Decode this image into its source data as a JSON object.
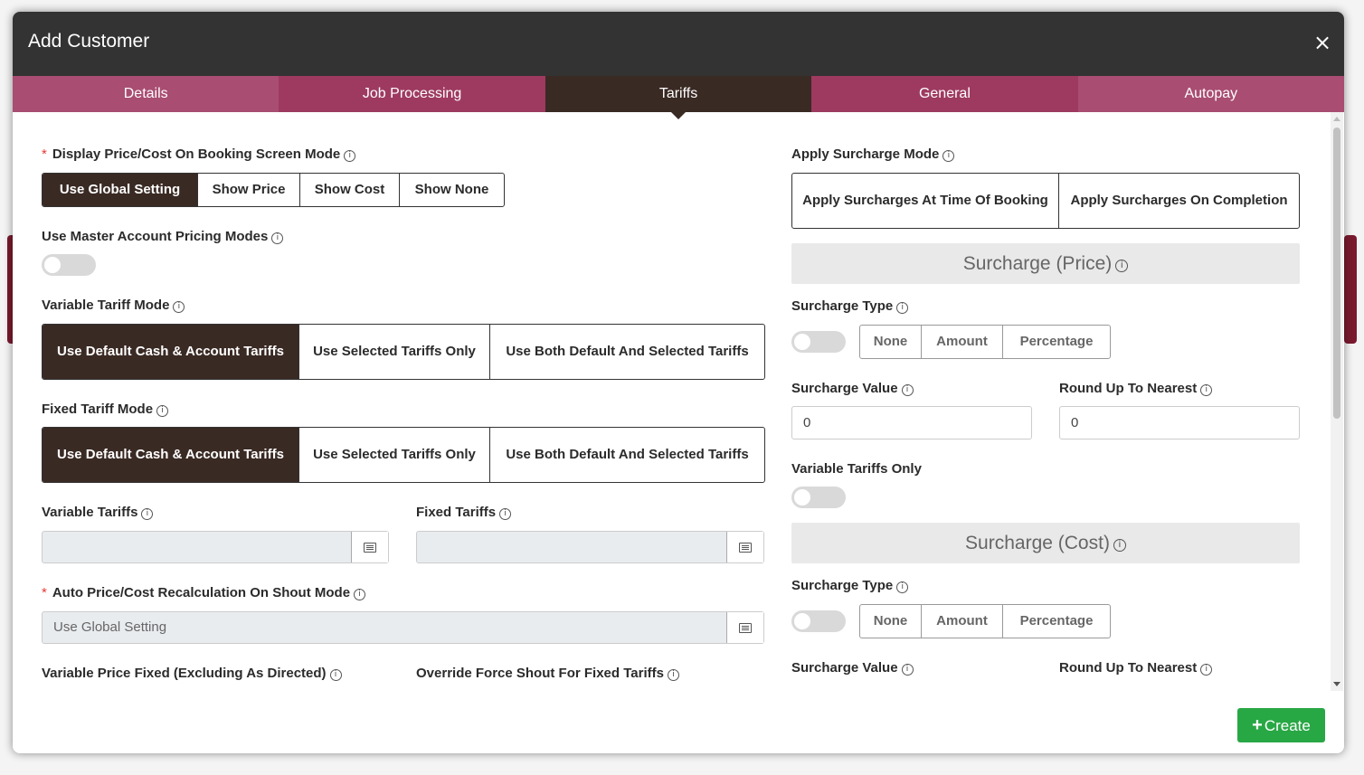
{
  "modal": {
    "title": "Add Customer",
    "close_glyph": "×"
  },
  "colors": {
    "header_bg": "#333333",
    "tab_bg": "#a94d72",
    "tab_bg_alt": "#9e3a60",
    "tab_active_bg": "#3a2a24",
    "segment_active_bg": "#3a2a24",
    "create_button_bg": "#28a745"
  },
  "tabs": [
    {
      "label": "Details",
      "active": false
    },
    {
      "label": "Job Processing",
      "active": false
    },
    {
      "label": "Tariffs",
      "active": true
    },
    {
      "label": "General",
      "active": false
    },
    {
      "label": "Autopay",
      "active": false
    }
  ],
  "left": {
    "display_price_mode": {
      "required_mark": "*",
      "label": "Display Price/Cost On Booking Screen Mode",
      "options": [
        "Use Global Setting",
        "Show Price",
        "Show Cost",
        "Show None"
      ],
      "selected": "Use Global Setting"
    },
    "master_pricing": {
      "label": "Use Master Account Pricing Modes",
      "enabled": false
    },
    "variable_tariff_mode": {
      "label": "Variable Tariff Mode",
      "options": [
        "Use Default Cash & Account Tariffs",
        "Use Selected Tariffs Only",
        "Use Both Default And Selected Tariffs"
      ],
      "selected": "Use Default Cash & Account Tariffs"
    },
    "fixed_tariff_mode": {
      "label": "Fixed Tariff Mode",
      "options": [
        "Use Default Cash & Account Tariffs",
        "Use Selected Tariffs Only",
        "Use Both Default And Selected Tariffs"
      ],
      "selected": "Use Default Cash & Account Tariffs"
    },
    "variable_tariffs": {
      "label": "Variable Tariffs",
      "value": ""
    },
    "fixed_tariffs": {
      "label": "Fixed Tariffs",
      "value": ""
    },
    "auto_recalc": {
      "required_mark": "*",
      "label": "Auto Price/Cost Recalculation On Shout Mode",
      "value": "Use Global Setting"
    },
    "variable_price_fixed": {
      "label": "Variable Price Fixed (Excluding As Directed)"
    },
    "override_force_shout": {
      "label": "Override Force Shout For Fixed Tariffs"
    }
  },
  "right": {
    "apply_surcharge_mode": {
      "label": "Apply Surcharge Mode",
      "options": [
        "Apply Surcharges At Time Of Booking",
        "Apply Surcharges On Completion"
      ]
    },
    "price_section": {
      "title": "Surcharge (Price)",
      "surcharge_type_label": "Surcharge Type",
      "type_enabled": false,
      "type_options": [
        "None",
        "Amount",
        "Percentage"
      ],
      "surcharge_value_label": "Surcharge Value",
      "surcharge_value": "0",
      "round_up_label": "Round Up To Nearest",
      "round_up_value": "0",
      "variable_only_label": "Variable Tariffs Only",
      "variable_only_enabled": false
    },
    "cost_section": {
      "title": "Surcharge (Cost)",
      "surcharge_type_label": "Surcharge Type",
      "type_enabled": false,
      "type_options": [
        "None",
        "Amount",
        "Percentage"
      ],
      "surcharge_value_label": "Surcharge Value",
      "round_up_label": "Round Up To Nearest"
    }
  },
  "icons": {
    "info": "info-icon",
    "list": "list-picker-icon",
    "close": "close-icon",
    "plus": "plus-icon"
  },
  "footer": {
    "create_plus": "+",
    "create_label": "Create"
  }
}
